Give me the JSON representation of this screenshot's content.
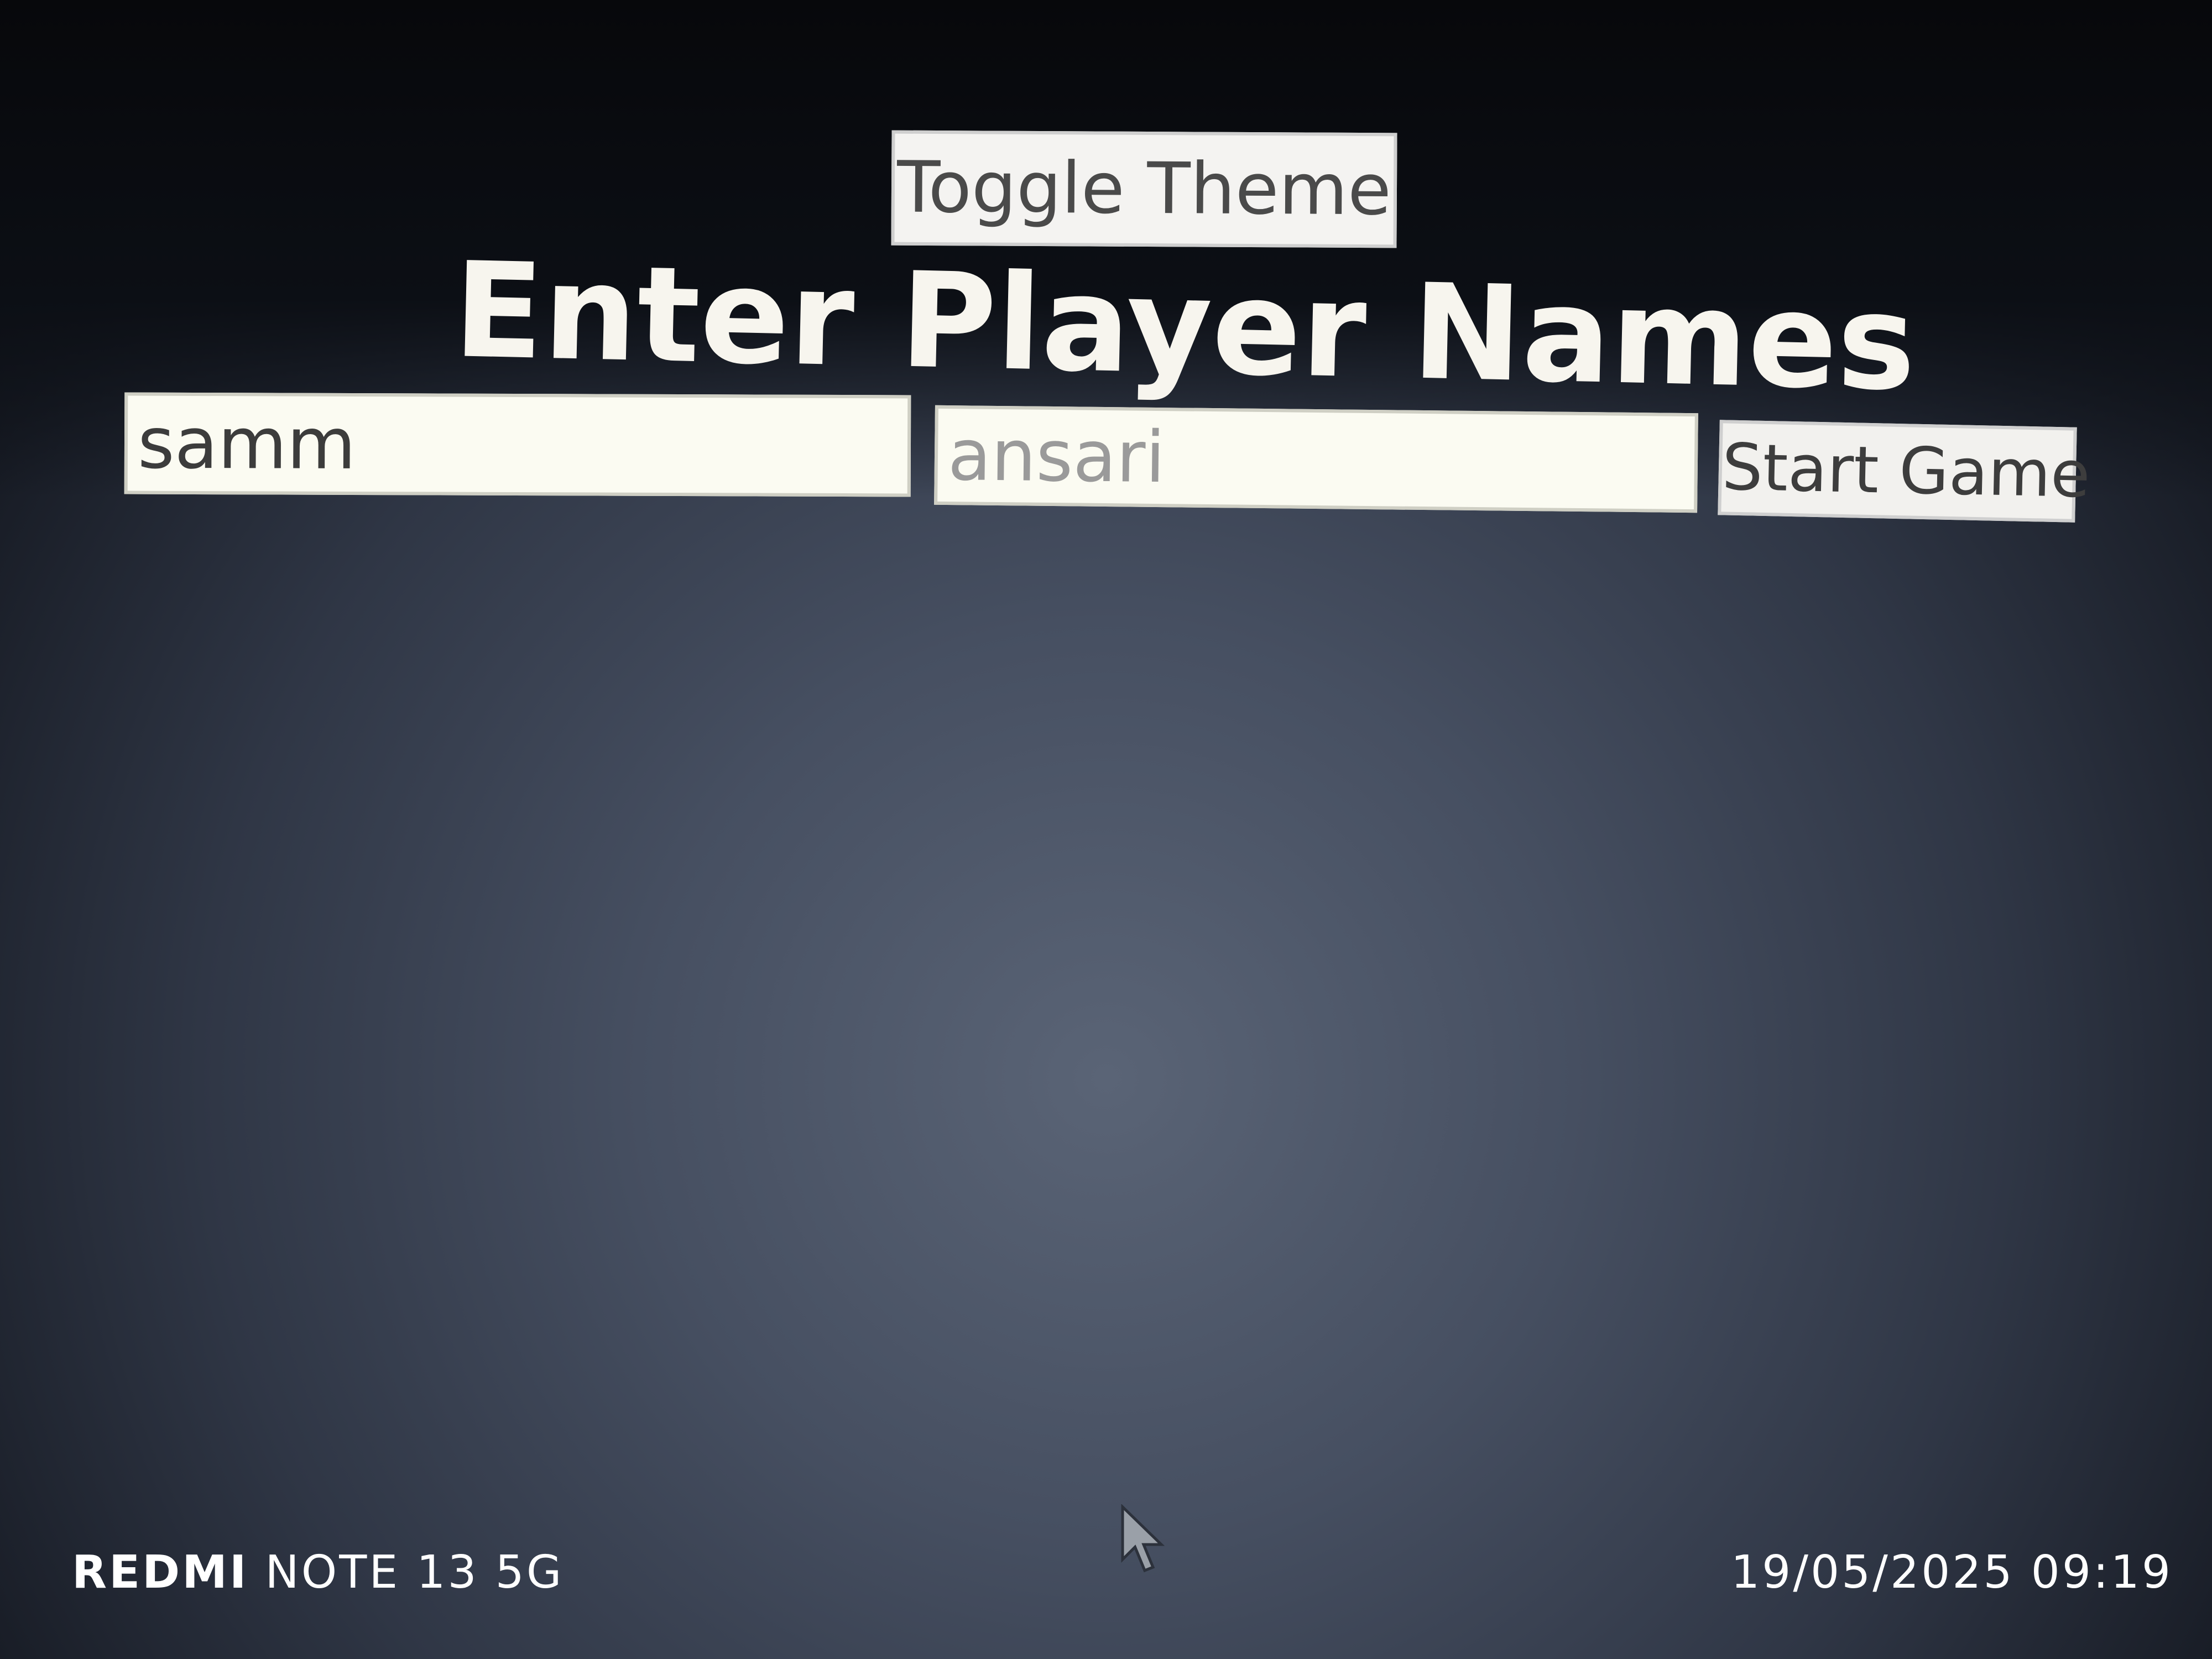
{
  "header": {
    "toggle_label": "Toggle Theme",
    "title": "Enter Player Names"
  },
  "form": {
    "player1_value": "samm",
    "player2_value": "ansari",
    "start_label": "Start Game"
  },
  "photo_watermark": {
    "brand": "REDMI",
    "model": "NOTE 13 5G",
    "datetime": "19/05/2025 09:19"
  },
  "colors": {
    "page_background": "#2f3645",
    "title_text": "#f7f5ee",
    "control_background": "#f4f3f1"
  },
  "icons": {
    "pointer": "mouse-cursor-icon"
  }
}
